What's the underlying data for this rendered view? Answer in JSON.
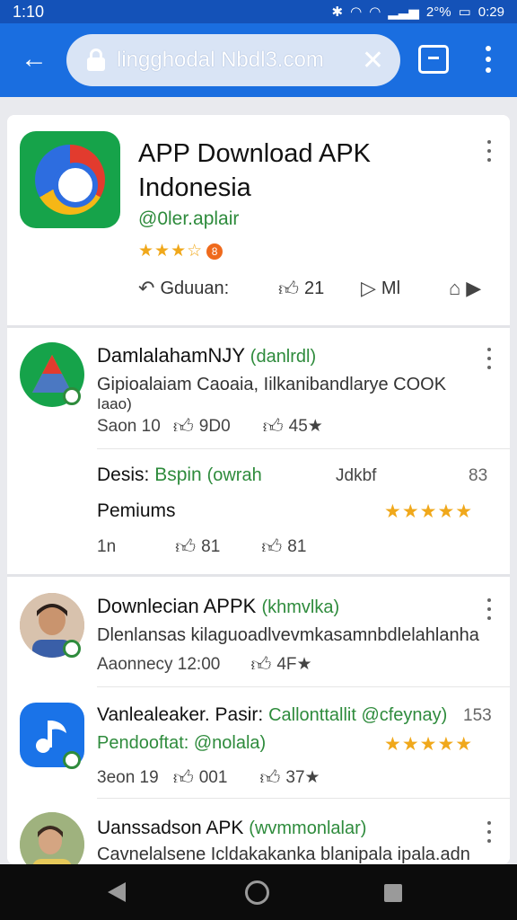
{
  "status": {
    "time": "1:10",
    "battery": "2°%",
    "clock": "0:29"
  },
  "browser": {
    "url": "lingghodal Nbdl3.com"
  },
  "main_app": {
    "title": "APP Download APK Indonesia",
    "developer": "@0ler.aplair",
    "rating_stars": "★★★☆",
    "rating_badge": "8",
    "actions": {
      "download": "Gduuan:",
      "like": "21",
      "share": "Ml"
    }
  },
  "list_section_1": {
    "item1": {
      "title": "DamlalahamNJY",
      "title_tag": "(danlrdl)",
      "desc": "Gipioalaiam Caoaia, Iilkanibandlarye COOK",
      "desc2": "Iaao)",
      "meta": {
        "left": "Saon  10",
        "likes": "9D0",
        "count": "45★"
      }
    },
    "item2": {
      "label": "Desis:",
      "badge": "Bspin",
      "tag": "(owrah",
      "extra": "Jdkbf",
      "num": "83",
      "premium": "Pemiums",
      "stars": "★★★★★",
      "meta": {
        "left": "1n",
        "likes1": "81",
        "likes2": "81"
      }
    }
  },
  "list_section_2": {
    "item1": {
      "title": "Downlecian APPK",
      "title_tag": "(khmvlka)",
      "desc": "Dlenlansas kilaguoadlvevmkasamnbdlelahlanha",
      "meta": {
        "left": "Aaonnecy 12:00",
        "count": "4F★"
      }
    },
    "item2": {
      "title": "Vanlealeaker. Pasir:",
      "title_green": "Callonttallit @cfeynay)",
      "num": "153",
      "subtitle": "Pendooftat: @nolala)",
      "stars": "★★★★★",
      "meta": {
        "left": "3eon 19",
        "likes": "001",
        "count": "37★"
      }
    },
    "item3": {
      "title": "Uanssadson APK",
      "title_tag": "(wvmmonlalar)",
      "desc": "Cavnelalsene Icldakakanka blanipala ipala.adn"
    }
  },
  "colors": {
    "toolbar": "#1a6ee0",
    "status_bar": "#1452b8",
    "accent_green": "#2e8b3c",
    "star": "#f0a81b"
  }
}
